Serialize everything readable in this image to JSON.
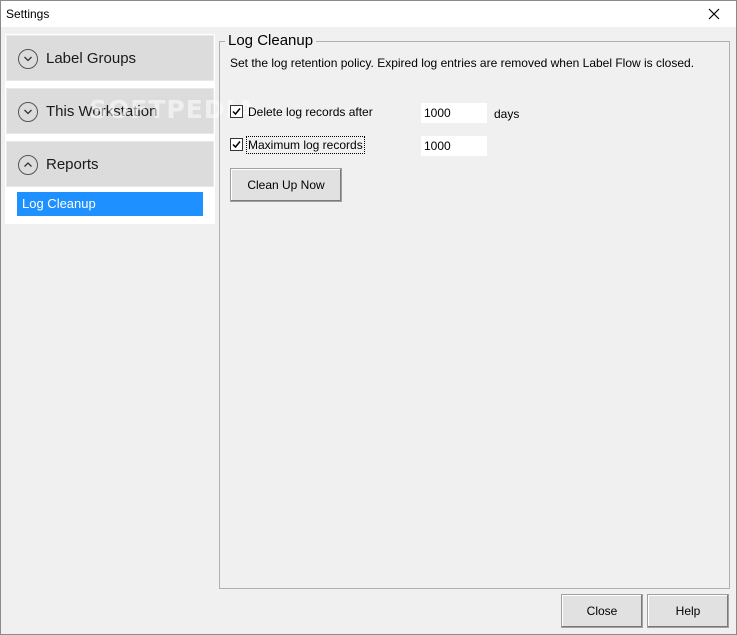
{
  "window": {
    "title": "Settings"
  },
  "nav": {
    "groups": [
      {
        "label": "Label Groups",
        "expanded": false
      },
      {
        "label": "This Workstation",
        "expanded": false
      },
      {
        "label": "Reports",
        "expanded": true
      }
    ],
    "sub_items": [
      {
        "label": "Log Cleanup",
        "selected": true
      }
    ]
  },
  "panel": {
    "title": "Log Cleanup",
    "description": "Set the log retention policy. Expired log entries are removed when Label Flow is closed.",
    "delete_after": {
      "label": "Delete log records after",
      "checked": true,
      "value": "1000",
      "unit": "days"
    },
    "max_records": {
      "label": "Maximum log records",
      "checked": true,
      "value": "1000"
    },
    "cleanup_button": "Clean Up Now"
  },
  "footer": {
    "close_label": "Close",
    "help_label": "Help"
  },
  "watermark": "SOFTPEDIA",
  "colors": {
    "selection": "#1e90ff",
    "nav_header": "#dcdcdc",
    "window_bg": "#f0f0f0"
  }
}
